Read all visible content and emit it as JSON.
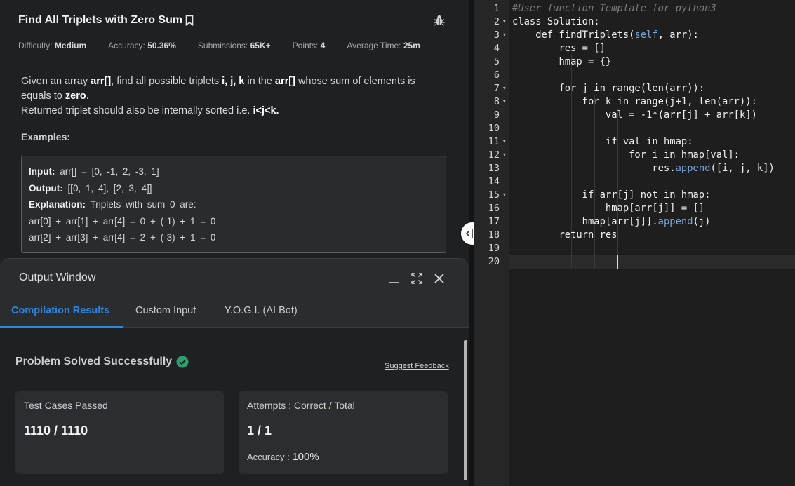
{
  "problem": {
    "title": "Find All Triplets with Zero Sum",
    "meta": [
      {
        "label": "Difficulty:",
        "value": "Medium"
      },
      {
        "label": "Accuracy:",
        "value": "50.36%"
      },
      {
        "label": "Submissions:",
        "value": "65K+"
      },
      {
        "label": "Points:",
        "value": "4"
      },
      {
        "label": "Average Time:",
        "value": "25m"
      }
    ],
    "desc": {
      "p1_a": "Given an array ",
      "p1_b": "arr[]",
      "p1_c": ", find all possible triplets ",
      "p1_d": "i, j, k",
      "p1_e": " in the ",
      "p1_f": "arr[]",
      "p1_g": " whose sum of elements is equals to ",
      "p1_h": "zero",
      "p1_i": ".",
      "p2_a": "Returned triplet should also be internally sorted i.e. ",
      "p2_b": "i<j<k."
    },
    "examples_title": "Examples:",
    "example": {
      "input_label": "Input:",
      "input_value": " arr[] = [0, -1, 2, -3, 1]",
      "output_label": "Output:",
      "output_value": " [[0, 1, 4], [2, 3, 4]]",
      "explanation_label": "Explanation:",
      "explanation_value": " Triplets with sum 0 are:",
      "line1": "arr[0] + arr[1] + arr[4] = 0 + (-1) + 1 = 0",
      "line2": "arr[2] + arr[3] + arr[4] = 2 + (-3) + 1 = 0"
    }
  },
  "output_window": {
    "title": "Output Window",
    "tabs": [
      "Compilation Results",
      "Custom Input",
      "Y.O.G.I. (AI Bot)"
    ],
    "status": "Problem Solved Successfully",
    "feedback": "Suggest Feedback",
    "cards": [
      {
        "label": "Test Cases Passed",
        "value": "1110 / 1110"
      },
      {
        "label": "Attempts : Correct / Total",
        "value": "1 / 1",
        "sub_label": "Accuracy :",
        "sub_value": "100%"
      }
    ]
  },
  "editor": {
    "line_numbers": [
      "1",
      "2",
      "3",
      "4",
      "5",
      "6",
      "7",
      "8",
      "9",
      "10",
      "11",
      "12",
      "13",
      "14",
      "15",
      "16",
      "17",
      "18",
      "19",
      "20"
    ],
    "lines": [
      "#User function Template for python3",
      "class Solution:",
      "    def findTriplets(self, arr):",
      "        res = []",
      "        hmap = {}",
      "",
      "        for j in range(len(arr)):",
      "            for k in range(j+1, len(arr)):",
      "                val = -1*(arr[j] + arr[k])",
      "",
      "                if val in hmap:",
      "                    for i in hmap[val]:",
      "                        res.append([i, j, k])",
      "",
      "            if arr[j] not in hmap:",
      "                hmap[arr[j]] = []",
      "            hmap[arr[j]].append(j)",
      "        return res",
      "",
      ""
    ]
  }
}
